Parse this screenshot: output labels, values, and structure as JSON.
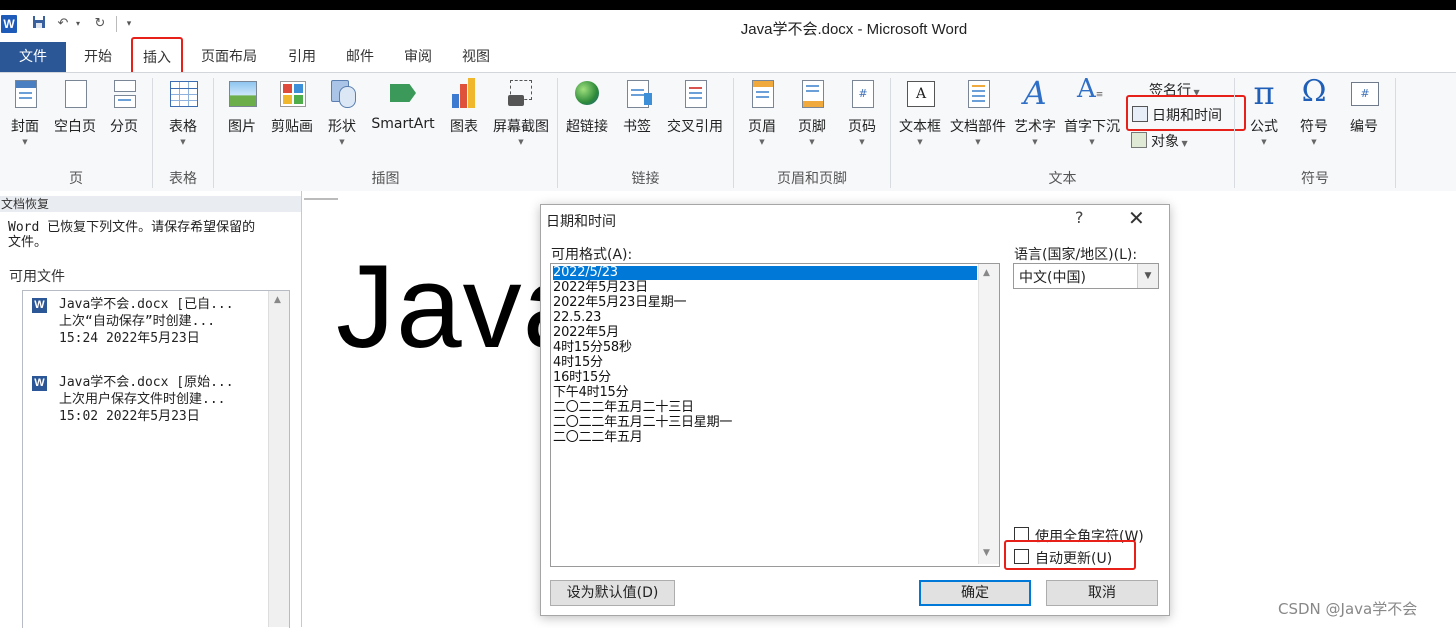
{
  "window": {
    "title": "Java学不会.docx - Microsoft Word",
    "app_icon_letter": "W"
  },
  "quick_access": {
    "save_icon": "save-icon",
    "undo_icon": "undo-icon",
    "redo_icon": "redo-icon",
    "customize_icon": "customize-qat-icon"
  },
  "ribbon_tabs": [
    "文件",
    "开始",
    "插入",
    "页面布局",
    "引用",
    "邮件",
    "审阅",
    "视图"
  ],
  "active_tab": "插入",
  "ribbon": {
    "buttons": {
      "cover": "封面",
      "blank_page": "空白页",
      "page_break": "分页",
      "table": "表格",
      "picture": "图片",
      "clipart": "剪贴画",
      "shapes": "形状",
      "smartart": "SmartArt",
      "chart": "图表",
      "screenshot": "屏幕截图",
      "hyperlink": "超链接",
      "bookmark": "书签",
      "cross_ref": "交叉引用",
      "header": "页眉",
      "footer": "页脚",
      "page_number": "页码",
      "textbox": "文本框",
      "quick_parts": "文档部件",
      "wordart": "艺术字",
      "dropcap": "首字下沉",
      "signature_line": "签名行",
      "date_time": "日期和时间",
      "object": "对象",
      "equation": "公式",
      "symbol": "符号",
      "numbering": "编号"
    },
    "groups": {
      "pages": "页",
      "tables": "表格",
      "illustrations": "插图",
      "links": "链接",
      "header_footer": "页眉和页脚",
      "text": "文本",
      "symbols": "符号"
    }
  },
  "recovery_pane": {
    "header": "文档恢复",
    "message_line1": "Word 已恢复下列文件。请保存希望保留的",
    "message_line2": "文件。",
    "available_label": "可用文件",
    "files": [
      {
        "name": "Java学不会.docx  [已自...",
        "desc": "上次“自动保存”时创建...",
        "time": "15:24 2022年5月23日"
      },
      {
        "name": "Java学不会.docx  [原始...",
        "desc": "上次用户保存文件时创建...",
        "time": "15:02 2022年5月23日"
      }
    ]
  },
  "document": {
    "visible_text": "Java"
  },
  "dialog": {
    "title": "日期和时间",
    "help": "?",
    "close": "✕",
    "formats_label": "可用格式(A):",
    "formats": [
      "2022/5/23",
      "2022年5月23日",
      "2022年5月23日星期一",
      "22.5.23",
      "2022年5月",
      "4时15分58秒",
      "4时15分",
      "16时15分",
      "下午4时15分",
      "二〇二二年五月二十三日",
      "二〇二二年五月二十三日星期一",
      "二〇二二年五月"
    ],
    "selected_format": "2022/5/23",
    "language_label": "语言(国家/地区)(L):",
    "language_value": "中文(中国)",
    "fullwidth_label": "使用全角字符(W)",
    "fullwidth_checked": false,
    "auto_update_label": "自动更新(U)",
    "auto_update_checked": false,
    "set_default": "设为默认值(D)",
    "ok": "确定",
    "cancel": "取消"
  },
  "watermark": "CSDN @Java学不会",
  "colors": {
    "file_tab": "#2b5797",
    "highlight_box": "#e8201a",
    "selection": "#0078d7"
  }
}
